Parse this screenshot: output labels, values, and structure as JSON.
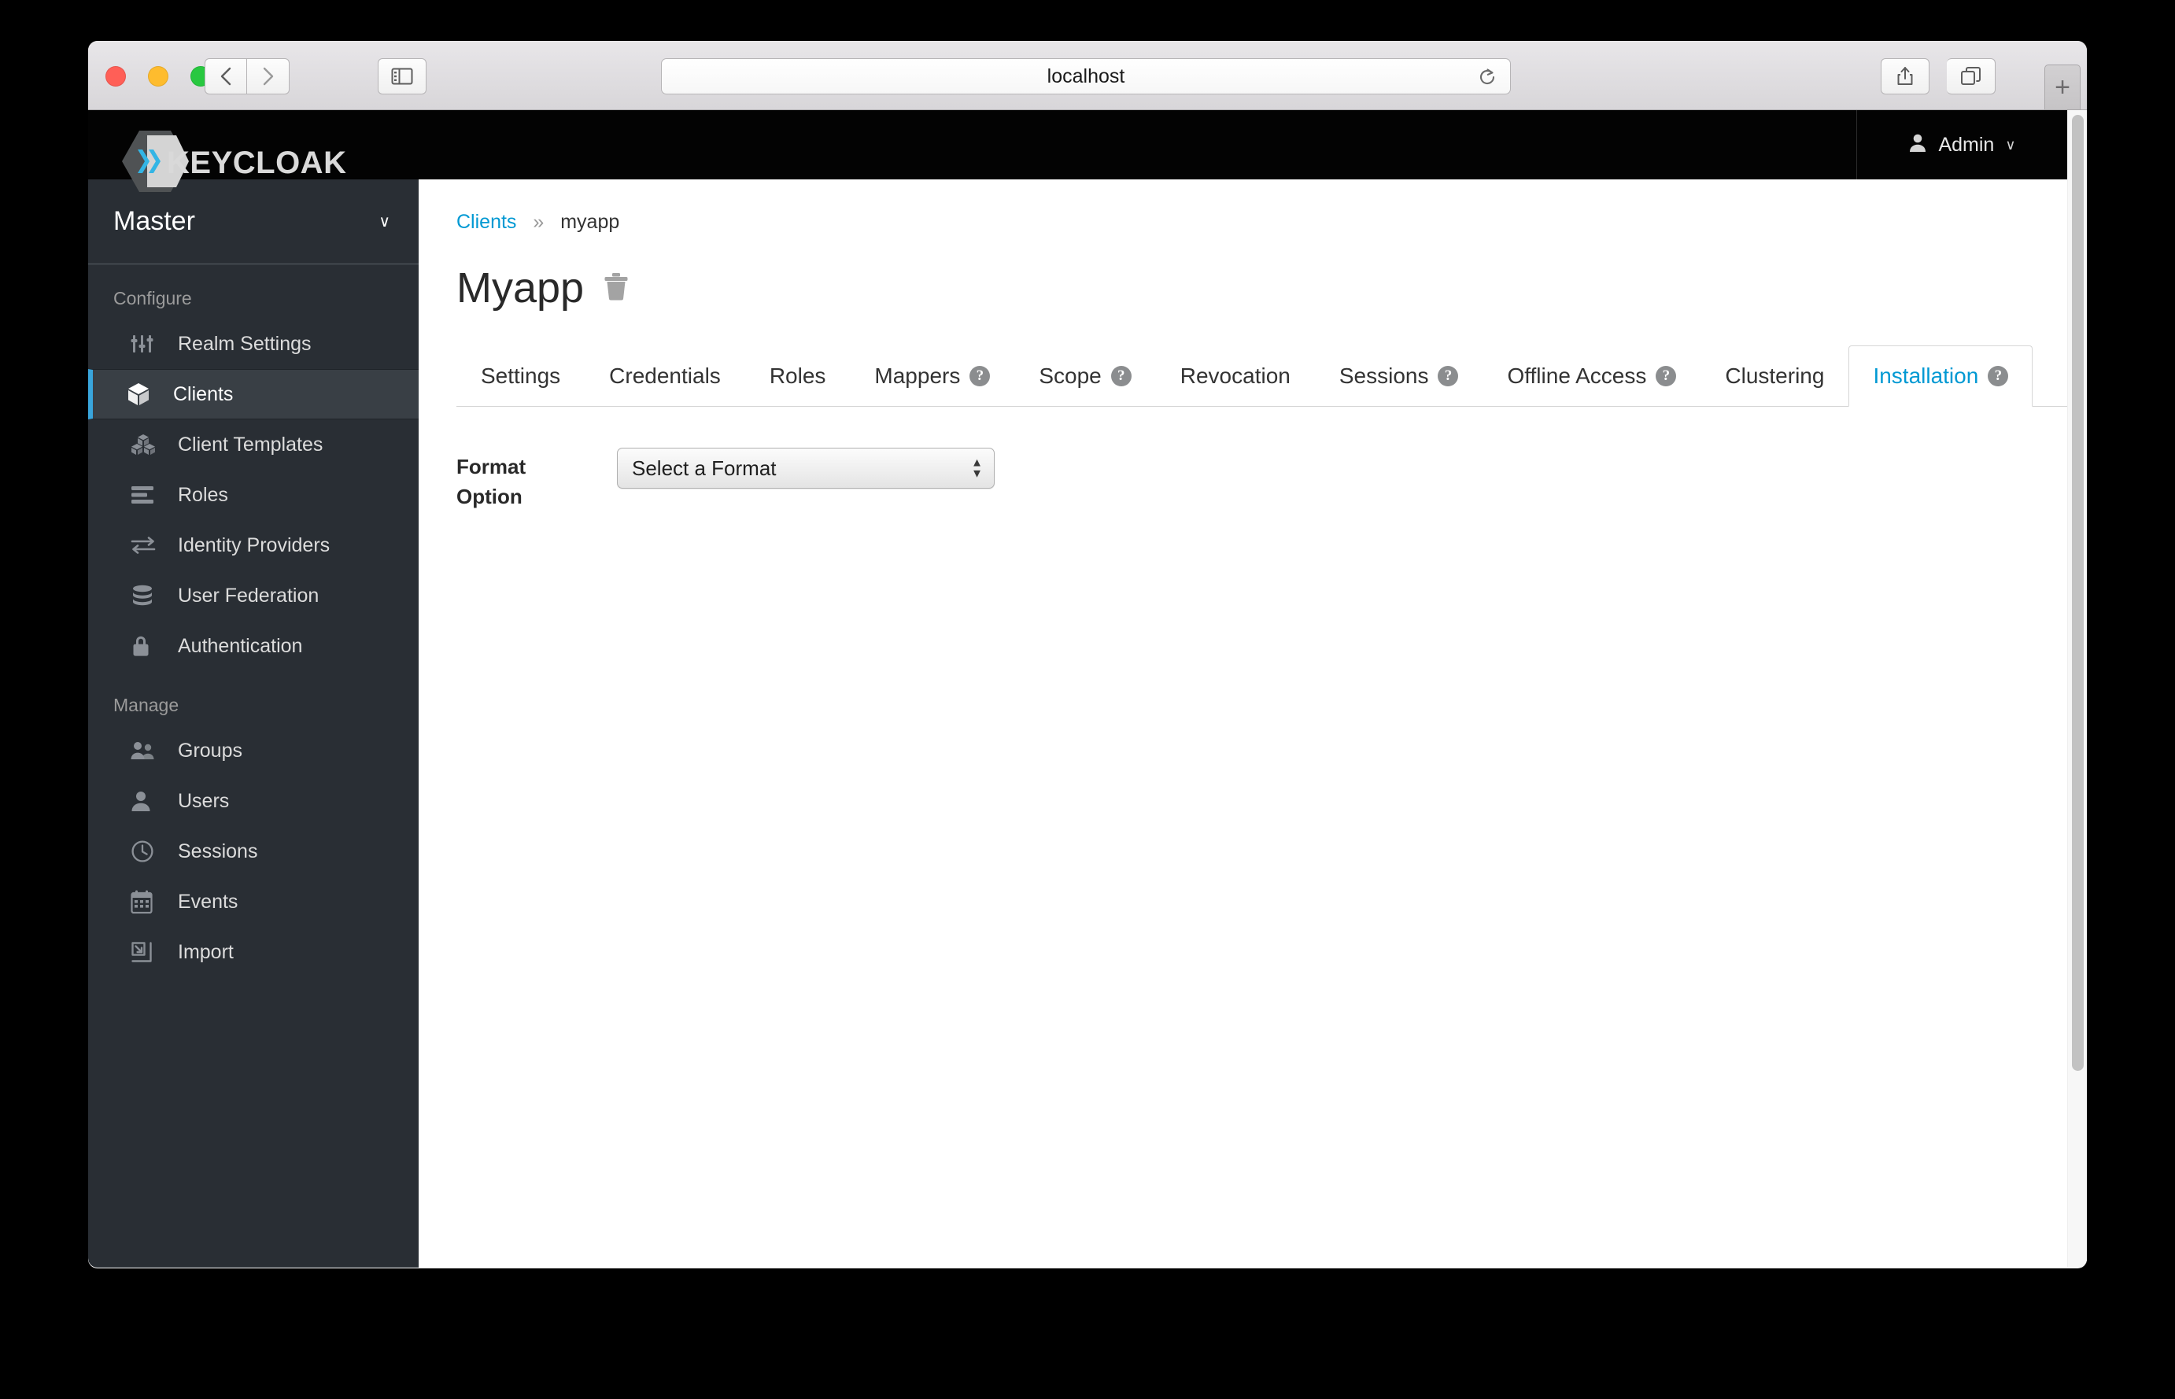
{
  "browser": {
    "url": "localhost",
    "back_label": "Back",
    "forward_label": "Forward",
    "sidebar_toggle_label": "Show Sidebar",
    "reload_label": "Reload",
    "share_label": "Share",
    "tab_overview_label": "Tab Overview",
    "new_tab_label": "+"
  },
  "header": {
    "brand": "KEYCLOAK",
    "user": "Admin",
    "user_chevron": "∨"
  },
  "sidebar": {
    "realm": "Master",
    "realm_chevron": "∨",
    "sections": [
      {
        "title": "Configure",
        "items": [
          {
            "label": "Realm Settings",
            "icon": "sliders-icon",
            "active": false
          },
          {
            "label": "Clients",
            "icon": "cube-icon",
            "active": true
          },
          {
            "label": "Client Templates",
            "icon": "cubes-icon",
            "active": false
          },
          {
            "label": "Roles",
            "icon": "list-icon",
            "active": false
          },
          {
            "label": "Identity Providers",
            "icon": "exchange-icon",
            "active": false
          },
          {
            "label": "User Federation",
            "icon": "database-icon",
            "active": false
          },
          {
            "label": "Authentication",
            "icon": "lock-icon",
            "active": false
          }
        ]
      },
      {
        "title": "Manage",
        "items": [
          {
            "label": "Groups",
            "icon": "group-icon",
            "active": false
          },
          {
            "label": "Users",
            "icon": "user-icon",
            "active": false
          },
          {
            "label": "Sessions",
            "icon": "clock-icon",
            "active": false
          },
          {
            "label": "Events",
            "icon": "calendar-icon",
            "active": false
          },
          {
            "label": "Import",
            "icon": "import-icon",
            "active": false
          }
        ]
      }
    ]
  },
  "main": {
    "breadcrumb": {
      "parent": "Clients",
      "separator": "»",
      "current": "myapp"
    },
    "title": "Myapp",
    "delete_label": "Delete",
    "tabs": [
      {
        "label": "Settings",
        "help": false,
        "active": false
      },
      {
        "label": "Credentials",
        "help": false,
        "active": false
      },
      {
        "label": "Roles",
        "help": false,
        "active": false
      },
      {
        "label": "Mappers",
        "help": true,
        "active": false
      },
      {
        "label": "Scope",
        "help": true,
        "active": false
      },
      {
        "label": "Revocation",
        "help": false,
        "active": false
      },
      {
        "label": "Sessions",
        "help": true,
        "active": false
      },
      {
        "label": "Offline Access",
        "help": true,
        "active": false
      },
      {
        "label": "Clustering",
        "help": false,
        "active": false
      },
      {
        "label": "Installation",
        "help": true,
        "active": true
      }
    ],
    "form": {
      "format_option_label": "Format Option",
      "format_option_value": "Select a Format"
    }
  },
  "colors": {
    "accent": "#0099d3",
    "sidebar_bg": "#292e34",
    "sidebar_active_bg": "#393f45",
    "sidebar_active_bar": "#39a5dc",
    "header_bg": "#030303"
  }
}
